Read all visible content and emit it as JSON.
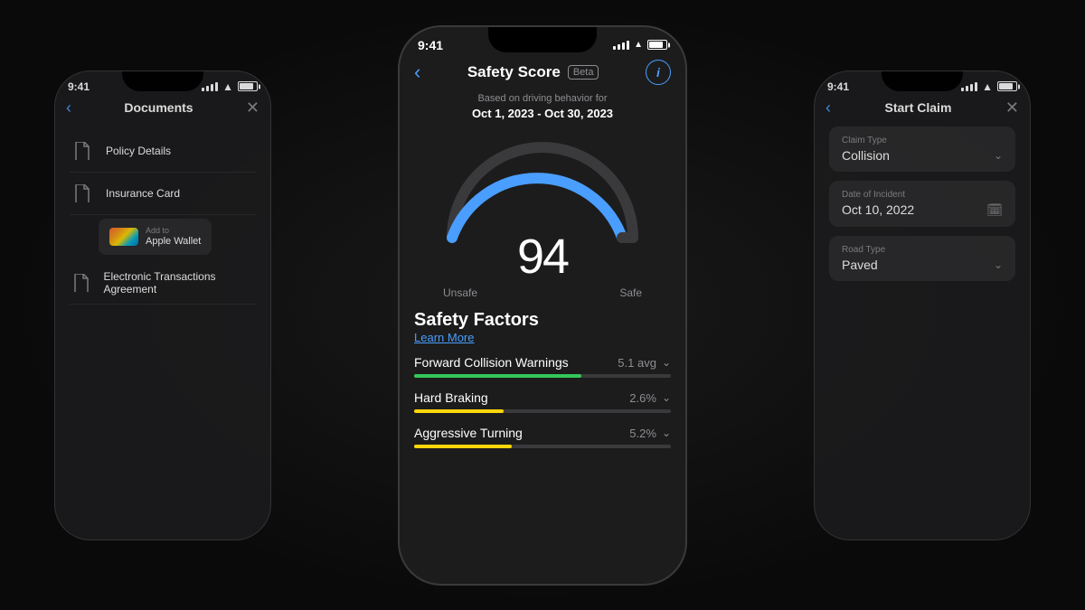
{
  "background": "#0a0a0a",
  "phones": {
    "left": {
      "time": "9:41",
      "title": "Documents",
      "documents": [
        {
          "name": "Policy Details",
          "icon": "📄"
        },
        {
          "name": "Insurance Card",
          "icon": "📄"
        },
        {
          "name": "Electronic Transactions Agreement",
          "icon": "📄"
        }
      ],
      "wallet": {
        "line1": "Add to",
        "line2": "Apple Wallet"
      }
    },
    "center": {
      "time": "9:41",
      "title": "Safety Score",
      "beta": "Beta",
      "date_subtitle": "Based on driving behavior for",
      "date_range": "Oct 1, 2023 - Oct 30, 2023",
      "score": "94",
      "gauge_unsafe": "Unsafe",
      "gauge_safe": "Safe",
      "factors_title": "Safety Factors",
      "learn_more": "Learn More",
      "factors": [
        {
          "name": "Forward Collision Warnings",
          "value": "5.1 avg",
          "color": "green",
          "fill_pct": 65
        },
        {
          "name": "Hard Braking",
          "value": "2.6%",
          "color": "yellow",
          "fill_pct": 35
        },
        {
          "name": "Aggressive Turning",
          "value": "5.2%",
          "color": "yellow",
          "fill_pct": 38
        }
      ]
    },
    "right": {
      "time": "9:41",
      "title": "Start Claim",
      "fields": [
        {
          "label": "Claim Type",
          "value": "Collision",
          "type": "dropdown"
        },
        {
          "label": "Date of Incident",
          "value": "Oct 10, 2022",
          "type": "calendar"
        },
        {
          "label": "Road Type",
          "value": "Paved",
          "type": "dropdown"
        }
      ]
    }
  }
}
